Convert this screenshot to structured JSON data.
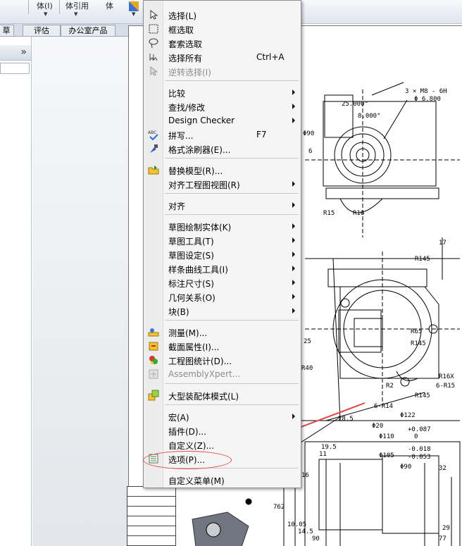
{
  "toolbar": {
    "items": [
      "体(I)",
      "体引用",
      "体"
    ]
  },
  "tabs": [
    "草图",
    "评估",
    "办公室产品"
  ],
  "menu": {
    "items": [
      {
        "label": "选择(L)",
        "icon": "arrow-select-icon"
      },
      {
        "label": "框选取",
        "icon": "box-select-icon"
      },
      {
        "label": "套索选取",
        "icon": "lasso-select-icon"
      },
      {
        "label": "选择所有",
        "shortcut": "Ctrl+A",
        "icon": "select-all-icon"
      },
      {
        "label": "逆转选择(I)",
        "disabled": true,
        "icon": "invert-select-icon"
      },
      {
        "label": "比较",
        "submenu": true
      },
      {
        "label": "查找/修改",
        "submenu": true
      },
      {
        "label": "Design Checker",
        "submenu": true
      },
      {
        "label": "拼写...",
        "shortcut": "F7",
        "icon": "spellcheck-icon"
      },
      {
        "label": "格式涂刷器(E)...",
        "icon": "format-painter-icon"
      },
      {
        "label": "替换模型(R)...",
        "icon": "replace-model-icon"
      },
      {
        "label": "对齐工程图视图(R)",
        "submenu": true
      },
      {
        "label": "对齐",
        "submenu": true
      },
      {
        "label": "草图绘制实体(K)",
        "submenu": true
      },
      {
        "label": "草图工具(T)",
        "submenu": true
      },
      {
        "label": "草图设定(S)",
        "submenu": true
      },
      {
        "label": "样条曲线工具(I)",
        "submenu": true
      },
      {
        "label": "标注尺寸(S)",
        "submenu": true
      },
      {
        "label": "几何关系(O)",
        "submenu": true
      },
      {
        "label": "块(B)",
        "submenu": true
      },
      {
        "label": "测量(M)...",
        "icon": "measure-icon"
      },
      {
        "label": "截面属性(I)...",
        "icon": "section-properties-icon"
      },
      {
        "label": "工程图统计(D)...",
        "icon": "drawing-statistics-icon"
      },
      {
        "label": "AssemblyXpert...",
        "disabled": true,
        "icon": "assemblyxpert-icon"
      },
      {
        "label": "大型装配体模式(L)",
        "icon": "large-assembly-icon"
      },
      {
        "label": "宏(A)",
        "submenu": true
      },
      {
        "label": "插件(D)..."
      },
      {
        "label": "自定义(Z)..."
      },
      {
        "label": "选项(P)...",
        "icon": "options-icon"
      },
      {
        "label": "自定义菜单(M)"
      }
    ]
  },
  "drawing": {
    "dims": [
      "3 × M8 - 6H",
      "Φ 6.800",
      "25.000°",
      "8.000°",
      "Φ90",
      "R15",
      "R16",
      "R145",
      "R65",
      "R145",
      "R40",
      "R2",
      "6-R15",
      "R145",
      "6-R14",
      "Φ122",
      "28.5",
      "Φ20",
      "+0.087",
      "Φ110",
      "0",
      "-0.018",
      "Φ105",
      "-0.053",
      "Φ90",
      "32",
      "19.5",
      "16",
      "11",
      "762",
      "25",
      "17",
      "6",
      "R16X",
      "10.05",
      "14.5",
      "90",
      "77",
      "29"
    ]
  },
  "colors": {
    "menu_bg": "#f5f5f5",
    "annotation": "#e04a4a"
  }
}
